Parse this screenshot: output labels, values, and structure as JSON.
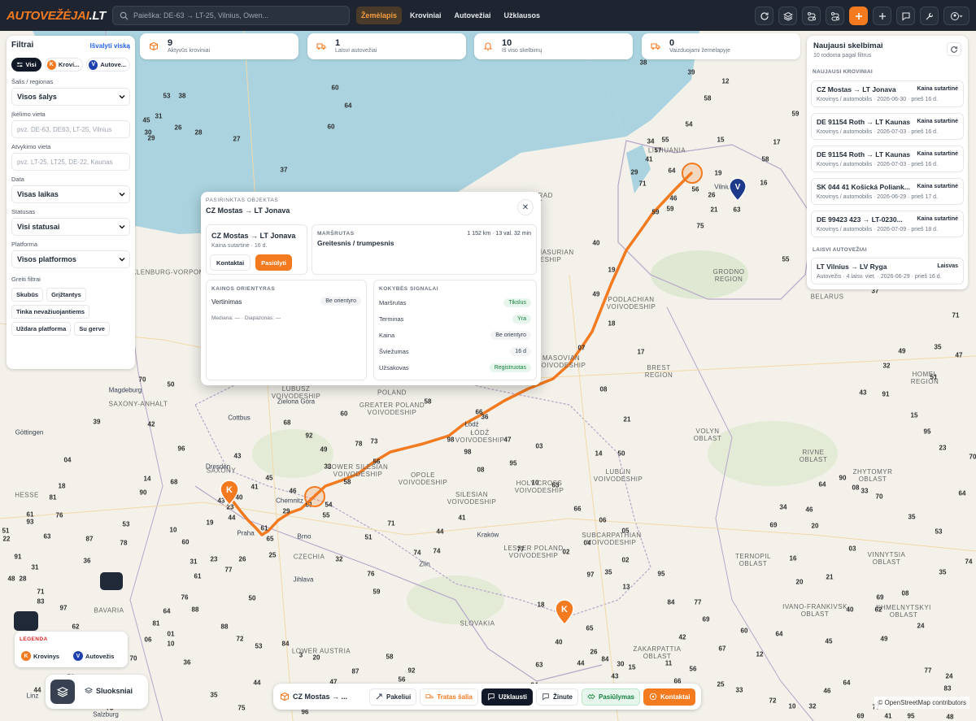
{
  "topbar": {
    "logo_main": "AUTOVEŽĖJAI",
    "logo_suffix": ".LT",
    "search_placeholder": "Paieška: DE-63 → LT-25, Vilnius, Owen...",
    "nav": [
      {
        "label": "Žemėlapis",
        "active": true
      },
      {
        "label": "Kroviniai",
        "active": false
      },
      {
        "label": "Autovežiai",
        "active": false
      },
      {
        "label": "Užklausos",
        "active": false
      }
    ],
    "tools": [
      "refresh-icon",
      "layers-icon",
      "route-icon",
      "route-alt-icon",
      "plus-icon",
      "plus-icon",
      "chat-icon",
      "tools-icon",
      "user-icon"
    ]
  },
  "stats": [
    {
      "value": "9",
      "label": "Aktyvūs kroviniai",
      "icon": "box-icon"
    },
    {
      "value": "1",
      "label": "Laisvi autovežiai",
      "icon": "truck-icon"
    },
    {
      "value": "10",
      "label": "Iš viso skelbimų",
      "icon": "bell-icon"
    },
    {
      "value": "0",
      "label": "Vaizduojami žemėlapyje",
      "icon": "truck-icon"
    }
  ],
  "filters": {
    "title": "Filtrai",
    "clear": "Išvalyti viską",
    "chips": [
      {
        "label": "Visi"
      },
      {
        "label": "Krovi...",
        "badge": "K"
      },
      {
        "label": "Autove...",
        "badge": "V"
      }
    ],
    "country_label": "Šalis / regionas",
    "country_value": "Visos šalys",
    "pickup_label": "Įkėlimo vieta",
    "pickup_placeholder": "pvz. DE-63, DE63, LT-25, Vilnius",
    "drop_label": "Atvykimo vieta",
    "drop_placeholder": "pvz. LT-25, LT25, DE-22, Kaunas",
    "date_label": "Data",
    "date_value": "Visas laikas",
    "status_label": "Statusas",
    "status_value": "Visi statusai",
    "platform_label": "Platforma",
    "platform_value": "Visos platformos",
    "quick_label": "Greiti filtrai",
    "quick": [
      "Skubūs",
      "Grįžtantys",
      "Tinka nevažiuojantiems",
      "Uždara platforma",
      "Su gerve"
    ]
  },
  "modal": {
    "kicker": "PASIRINKTAS OBJEKTAS",
    "title": "CZ Mostas → LT Jonava",
    "card_title": "CZ Mostas → LT Jonava",
    "card_sub": "Kaina sutartinė · 16 d.",
    "btn_contacts": "Kontaktai",
    "btn_offer": "Pasiūlyti",
    "route_kicker": "MARŠRUTAS",
    "route_meta": "1 152 km · 13 val. 32 min",
    "route_value": "Greitesnis / trumpesnis",
    "price_kicker": "KAINOS ORIENTYRAS",
    "price_label": "Vertinimas",
    "price_pill": "Be orientyro",
    "price_sub": "Mediana: — · Diapazonas: —",
    "quality_kicker": "KOKYBĖS SIGNALAI",
    "signals": [
      {
        "k": "Maršrutas",
        "v": "Tikslus",
        "green": true
      },
      {
        "k": "Terminas",
        "v": "Yra",
        "green": true
      },
      {
        "k": "Kaina",
        "v": "Be orientyro",
        "green": false
      },
      {
        "k": "Šviežumas",
        "v": "16 d",
        "green": false
      },
      {
        "k": "Užsakovas",
        "v": "Registruotas",
        "green": true
      }
    ]
  },
  "right_panel": {
    "title": "Naujausi skelbimai",
    "subtitle": "10 rodoma pagal filtrus",
    "section_cargo": "NAUJAUSI KROVINIAI",
    "section_trucks": "LAISVI AUTOVEŽIAI",
    "cargo": [
      {
        "title": "CZ Mostas → LT Jonava",
        "price": "Kaina sutartinė",
        "sub": "Krovinys / automobilis · 2026-06-30 · prieš 16 d."
      },
      {
        "title": "DE 91154 Roth → LT Kaunas",
        "price": "Kaina sutartinė",
        "sub": "Krovinys / automobilis · 2026-07-03 · prieš 16 d."
      },
      {
        "title": "DE 91154 Roth → LT Kaunas",
        "price": "Kaina sutartinė",
        "sub": "Krovinys / automobilis · 2026-07-03 · prieš 16 d."
      },
      {
        "title": "SK 044 41 Košická Poliank...",
        "price": "Kaina sutartinė",
        "sub": "Krovinys / automobilis · 2026-06-29 · prieš 17 d."
      },
      {
        "title": "DE 99423 423 → LT-0230...",
        "price": "Kaina sutartinė",
        "sub": "Krovinys / automobilis · 2026-07-09 · prieš 18 d."
      }
    ],
    "trucks": [
      {
        "title": "LT Vilnius → LV Ryga",
        "price": "Laisvas",
        "sub": "Autovežis · 4 laisv. viet. · 2026-06-29 · prieš 16 d."
      }
    ]
  },
  "legend": {
    "title": "LEGENDA",
    "items": [
      {
        "badge": "K",
        "label": "Krovinys"
      },
      {
        "badge": "V",
        "label": "Autovežis"
      }
    ]
  },
  "layers_label": "Sluoksniai",
  "bottom_bar": {
    "title": "CZ Mostas → ...",
    "buttons": [
      "Pakeliui",
      "Tratas šalia",
      "Užklausti",
      "Žinute",
      "Pasiūlymas",
      "Kontaktai"
    ]
  },
  "attribution": "© OpenStreetMap contributors",
  "map": {
    "region_labels": [
      "LITHUANIA",
      "KALININGRAD OBLAST",
      "WARMIAN-MASURIAN VOIVODESHIP",
      "GRODNO REGION",
      "PODLACHIAN VOIVODESHIP",
      "MASOVIAN VOIVODESHIP",
      "BREST REGION",
      "HOMEL REGION",
      "MECKLENBURG-VORPOMMERN",
      "LUBUSZ VOIVODESHIP",
      "POLAND",
      "GREATER POLAND VOIVODESHIP",
      "ŁÓDŹ VOIVODESHIP",
      "LUBLIN VOIVODESHIP",
      "VOLYN OBLAST",
      "RIVNE OBLAST",
      "ZHYTOMYR OBLAST",
      "SAXONY-ANHALT",
      "SAXONY",
      "HESSE",
      "OPOLE VOIVODESHIP",
      "SILESIAN VOIVODESHIP",
      "HOLY CROSS VOIVODESHIP",
      "LOWER SILESIAN VOIVODESHIP",
      "LESSER POLAND VOIVODESHIP",
      "SUBCARPATHIAN VOIVODESHIP",
      "CZECHIA",
      "BAVARIA",
      "LOWER AUSTRIA",
      "SLOVAKIA",
      "TERNOPIL OBLAST",
      "KHMELNYTSKYI OBLAST",
      "IVANO-FRANKIVSK OBLAST",
      "ZAKARPATTIA OBLAST",
      "VINNYTSIA OBLAST",
      "BELARUS"
    ],
    "city_labels": [
      "Magdeburg",
      "Dresden",
      "Praha",
      "Kraków",
      "Zielona Góra",
      "Cottbus",
      "Göttingen",
      "Chemnitz",
      "Brno",
      "Zlín",
      "Jihlava",
      "Linz",
      "Salzburg",
      "Vilnius",
      "Łódź"
    ]
  }
}
